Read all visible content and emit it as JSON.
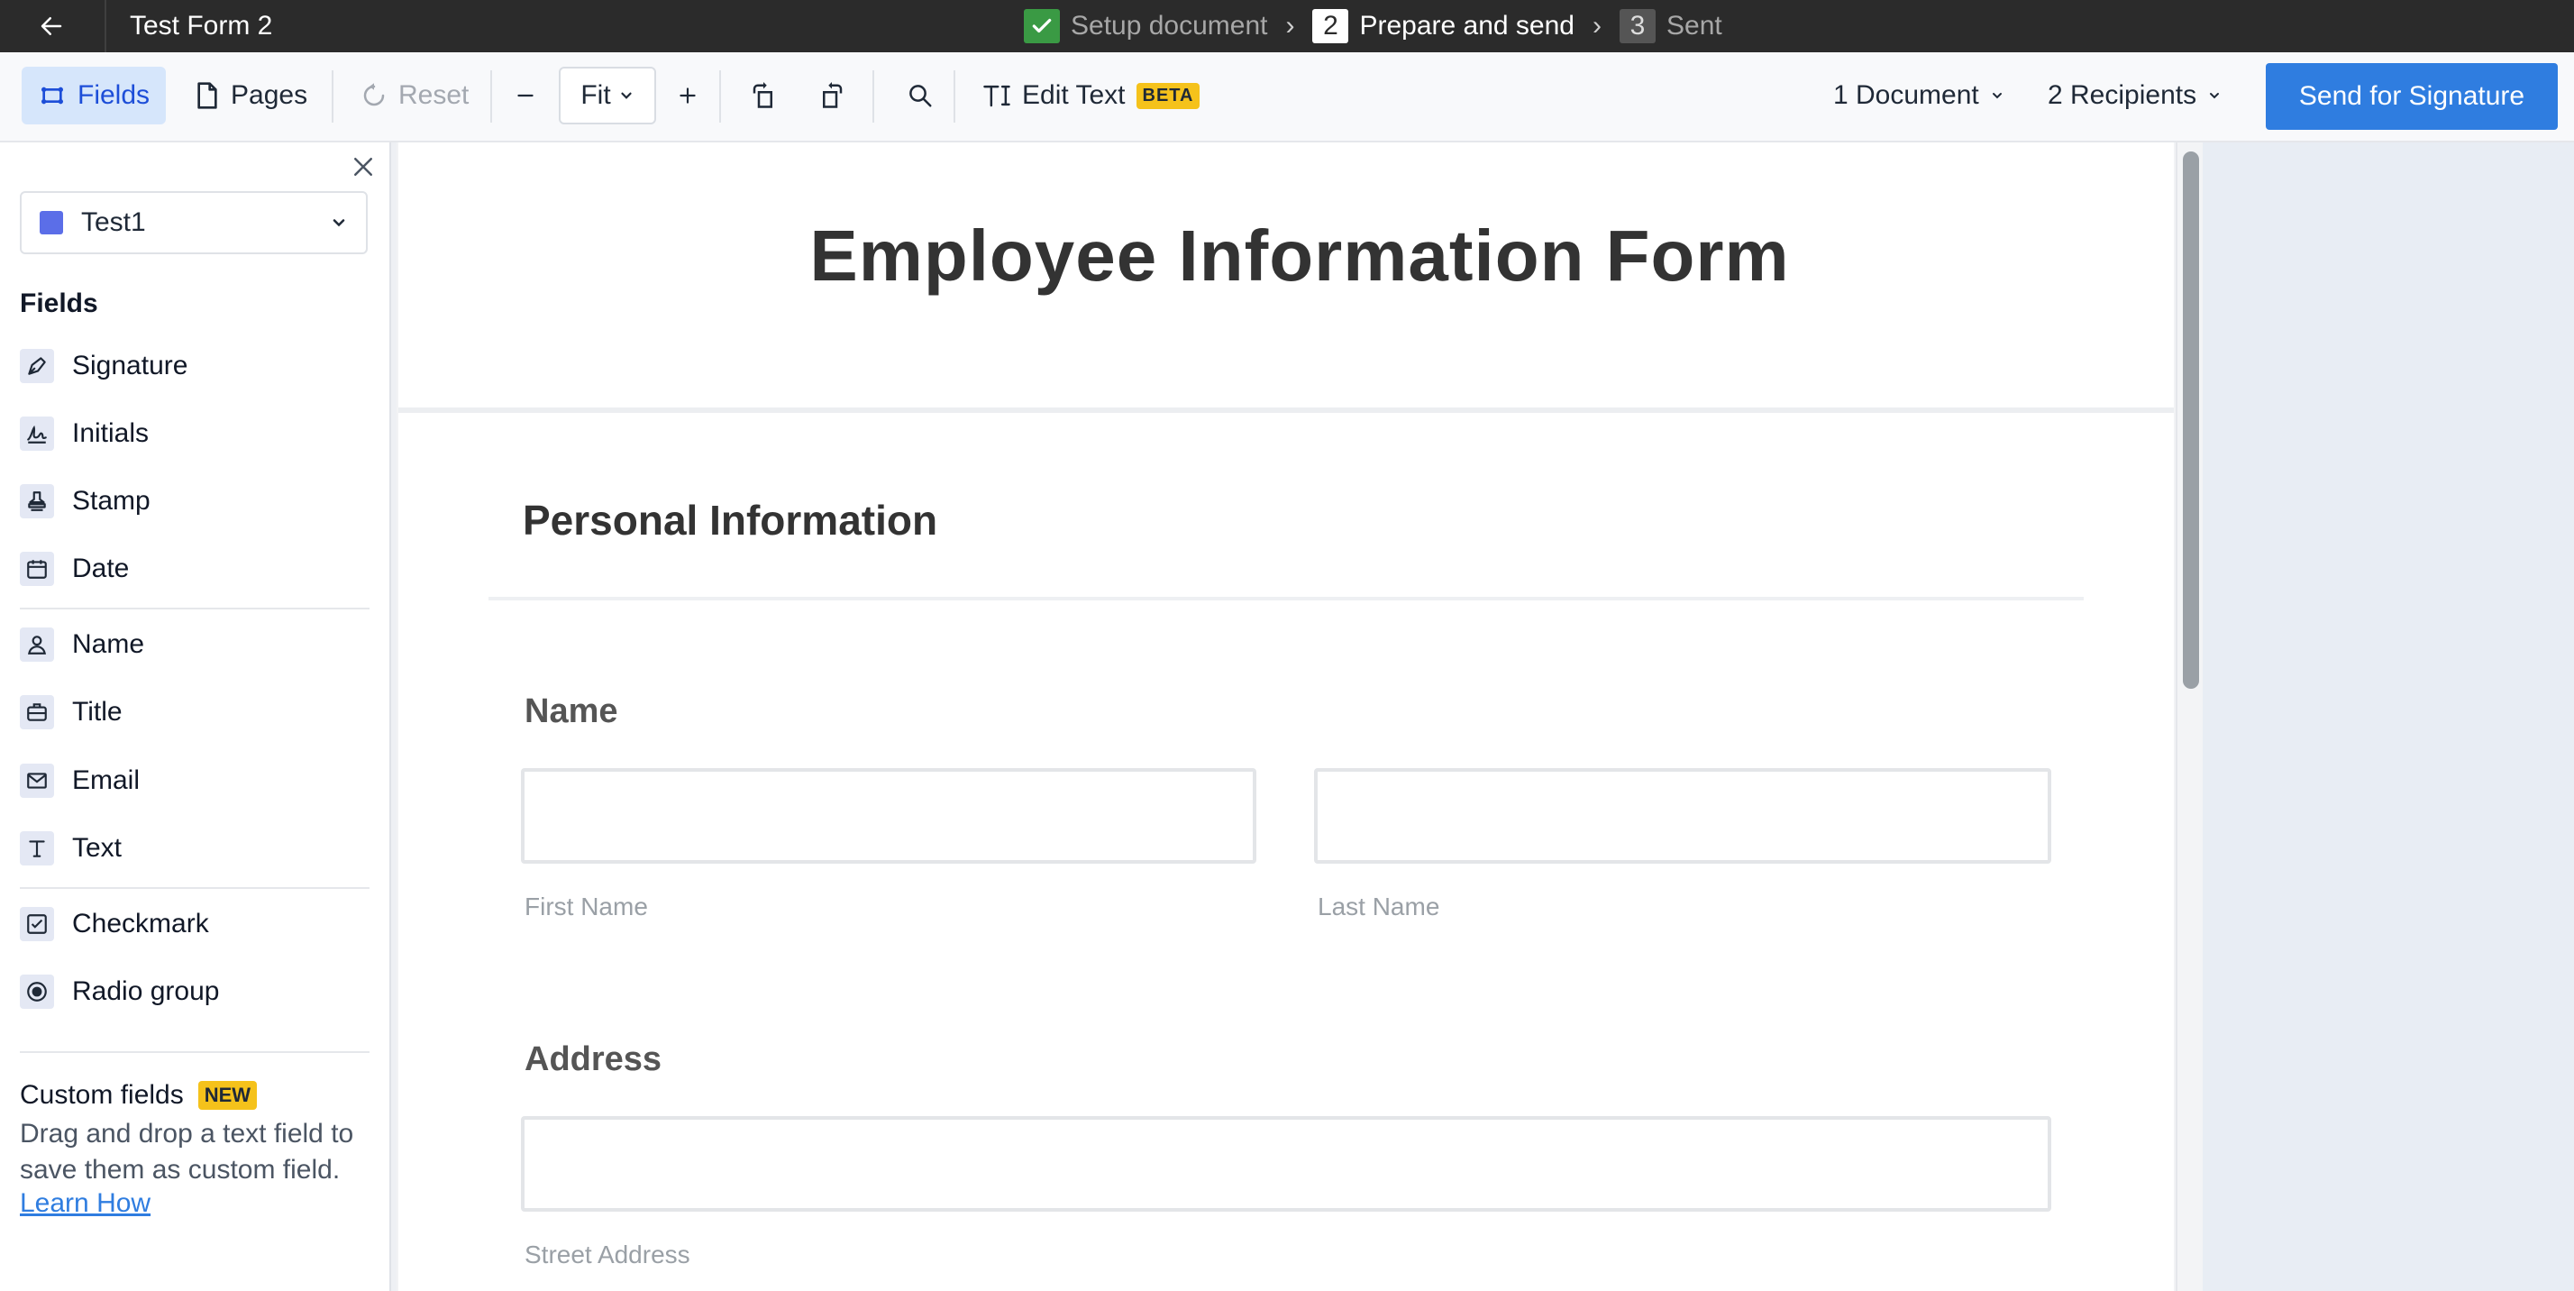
{
  "topbar": {
    "title": "Test Form 2",
    "steps": [
      {
        "label": "Setup document",
        "state": "done"
      },
      {
        "number": "2",
        "label": "Prepare and send",
        "state": "active"
      },
      {
        "number": "3",
        "label": "Sent",
        "state": "todo"
      }
    ],
    "separator": "›"
  },
  "toolbar": {
    "fields_label": "Fields",
    "pages_label": "Pages",
    "reset_label": "Reset",
    "zoom_label": "Fit",
    "edit_text_label": "Edit Text",
    "beta_badge": "BETA",
    "documents_label": "1 Document",
    "recipients_label": "2 Recipients",
    "send_label": "Send for Signature"
  },
  "sidebar": {
    "recipient": {
      "name": "Test1",
      "color": "#5b6ee8"
    },
    "fields_heading": "Fields",
    "fields": [
      {
        "label": "Signature",
        "icon": "pen-icon"
      },
      {
        "label": "Initials",
        "icon": "initials-icon"
      },
      {
        "label": "Stamp",
        "icon": "stamp-icon"
      },
      {
        "label": "Date",
        "icon": "calendar-icon"
      },
      {
        "label": "Name",
        "icon": "person-icon"
      },
      {
        "label": "Title",
        "icon": "briefcase-icon"
      },
      {
        "label": "Email",
        "icon": "envelope-icon"
      },
      {
        "label": "Text",
        "icon": "text-icon"
      },
      {
        "label": "Checkmark",
        "icon": "checkbox-icon"
      },
      {
        "label": "Radio group",
        "icon": "radio-icon"
      }
    ],
    "custom": {
      "heading": "Custom fields",
      "badge": "NEW",
      "description": "Drag and drop a text field to save them as custom field.",
      "link": "Learn How"
    }
  },
  "document": {
    "title": "Employee Information Form",
    "section": "Personal Information",
    "name_label": "Name",
    "first_name": "First Name",
    "last_name": "Last Name",
    "address_label": "Address",
    "street_address": "Street Address"
  },
  "colors": {
    "accent": "#2f7de0",
    "topbar": "#2b2b2b",
    "badge": "#f5c21b",
    "done": "#3a9a44"
  }
}
